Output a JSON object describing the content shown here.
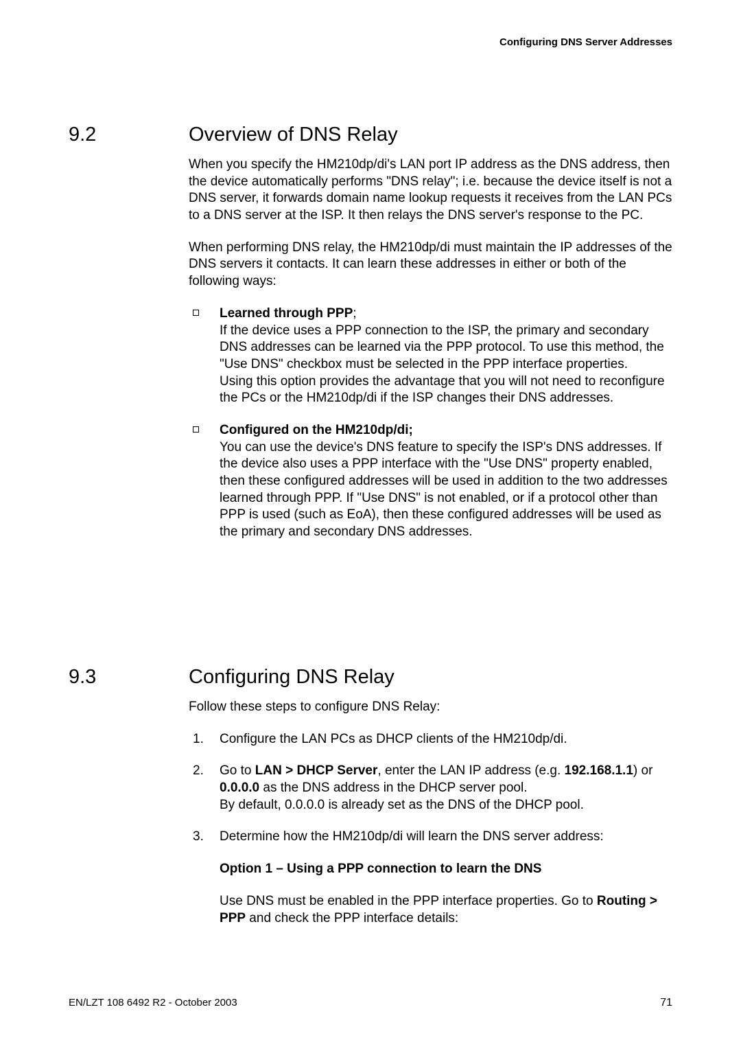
{
  "header": {
    "running_title": "Configuring DNS Server Addresses"
  },
  "section92": {
    "num": "9.2",
    "title": "Overview of DNS Relay",
    "para1": "When you specify the HM210dp/di's LAN port IP address as the DNS address, then the device automatically performs \"DNS relay\"; i.e. because the device itself is not a DNS server, it forwards domain name lookup requests it receives from the LAN PCs to a DNS server at the ISP. It then relays the DNS server's response to the PC.",
    "para2": "When performing DNS relay, the HM210dp/di must maintain the IP addresses of the DNS servers it contacts. It can learn these addresses in either or both of the following ways:",
    "bullets": [
      {
        "bold": "Learned through PPP",
        "after_bold": ";",
        "body": "If the device uses a PPP connection to the ISP, the primary and secondary DNS addresses can be learned via the PPP protocol. To use this method, the \"Use DNS\" checkbox must be selected in the PPP interface properties.",
        "body2": "Using this option provides the advantage that you will not need to reconfigure the PCs or the HM210dp/di if the ISP changes their DNS addresses."
      },
      {
        "bold": "Configured on the HM210dp/di;",
        "after_bold": "",
        "body": "You can use the device's DNS feature to specify the ISP's DNS addresses. If the device also uses a PPP interface with the \"Use DNS\" property enabled, then these configured addresses will be used in addition to the two addresses learned through PPP. If \"Use DNS\" is not enabled, or if a protocol other than PPP is used (such as EoA), then these configured addresses will be used as the primary and secondary DNS addresses.",
        "body2": ""
      }
    ]
  },
  "section93": {
    "num": "9.3",
    "title": "Configuring DNS Relay",
    "intro": "Follow these steps to configure DNS Relay:",
    "steps": [
      {
        "marker": "1.",
        "plain": "Configure the LAN PCs as DHCP clients of the HM210dp/di."
      },
      {
        "marker": "2.",
        "pre": "Go to ",
        "b1": "LAN > DHCP Server",
        "mid1": ", enter the LAN IP address (e.g. ",
        "b2": "192.168.1.1",
        "mid2": ") or ",
        "b3": "0.0.0.0",
        "mid3": " as the DNS address in the DHCP server pool.",
        "tail": "By default, 0.0.0.0 is already set as the DNS of the DHCP pool."
      },
      {
        "marker": "3.",
        "plain": "Determine how the HM210dp/di will learn the DNS server address:"
      }
    ],
    "option_heading": "Option 1 – Using a PPP connection to learn the DNS",
    "option_body_pre": "Use DNS must be enabled in the PPP interface properties. Go to ",
    "option_body_bold": "Routing > PPP",
    "option_body_post": " and check the PPP interface details:"
  },
  "footer": {
    "left": "EN/LZT 108 6492 R2 - October 2003",
    "page": "71"
  }
}
